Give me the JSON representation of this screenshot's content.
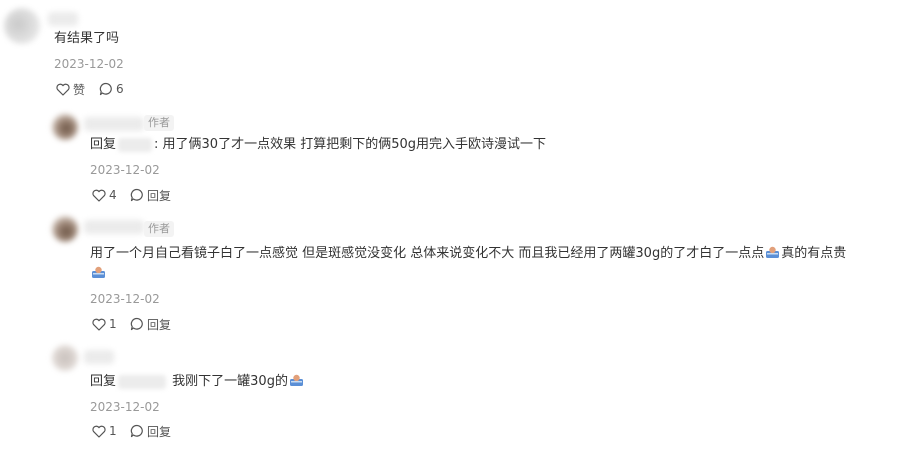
{
  "comments": [
    {
      "text": "有结果了吗",
      "date": "2023-12-02",
      "like_label": "赞",
      "reply_count": "6"
    },
    {
      "author_tag": "作者",
      "reply_prefix": "回复",
      "text": ": 用了俩30了才一点效果 打算把剩下的俩50g用完入手欧诗漫试一下",
      "date": "2023-12-02",
      "like_count": "4",
      "reply_label": "回复"
    },
    {
      "author_tag": "作者",
      "text_part1": "用了一个月自己看镜子白了一点感觉 但是斑感觉没变化 总体来说变化不大 而且我已经用了两罐30g的了才白了一点点",
      "text_part2": "真的有点贵",
      "date": "2023-12-02",
      "like_count": "1",
      "reply_label": "回复"
    },
    {
      "reply_prefix": "回复",
      "text": " 我刚下了一罐30g的",
      "date": "2023-12-02",
      "like_count": "1",
      "reply_label": "回复"
    }
  ]
}
